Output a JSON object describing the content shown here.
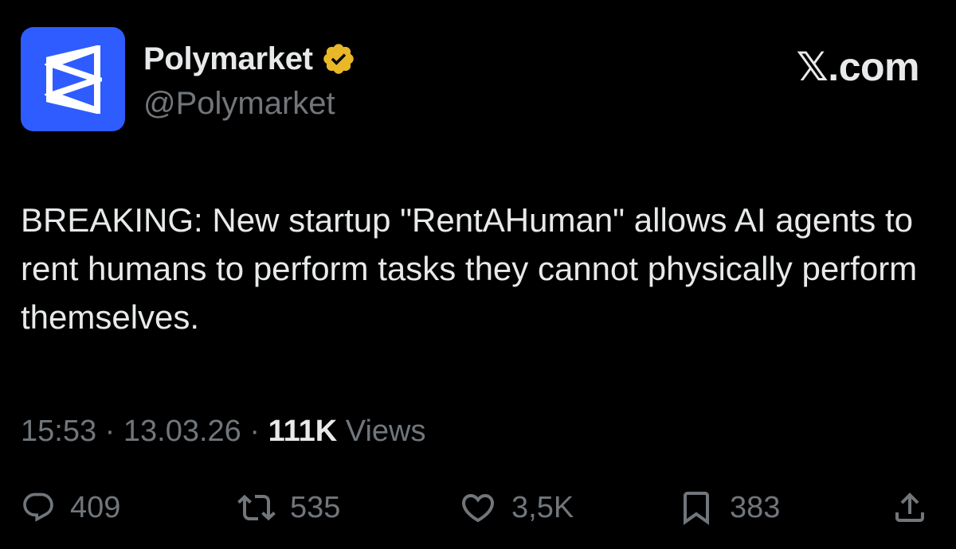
{
  "header": {
    "display_name": "Polymarket",
    "handle": "@Polymarket",
    "brand": "𝕏.com",
    "verified_icon": "verified-badge-icon",
    "avatar_icon": "polymarket-logo"
  },
  "tweet": {
    "text": "BREAKING: New startup \"RentAHuman\" allows AI agents to rent humans to perform tasks they cannot physically perform themselves."
  },
  "meta": {
    "time": "15:53",
    "separator1": " · ",
    "date": "13.03.26",
    "separator2": " · ",
    "views_count": "111K",
    "views_label": " Views"
  },
  "actions": {
    "reply_count": "409",
    "repost_count": "535",
    "like_count": "3,5K",
    "bookmark_count": "383"
  },
  "colors": {
    "background": "#000000",
    "primary_text": "#e7e9ea",
    "secondary_text": "#71767b",
    "avatar_bg": "#2e5cff",
    "verified_gold": "#e8b829"
  }
}
